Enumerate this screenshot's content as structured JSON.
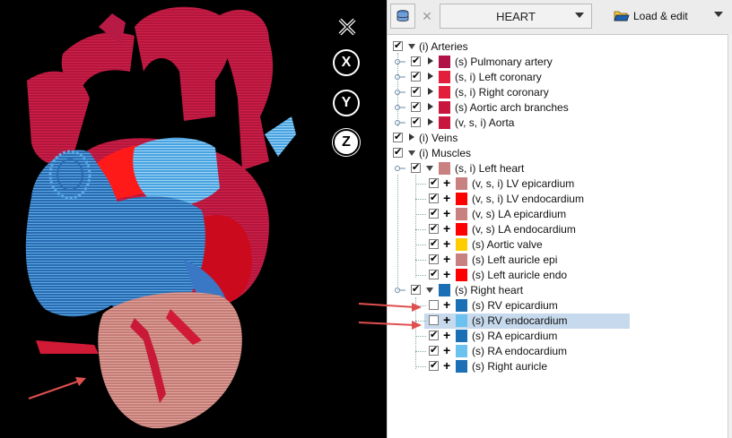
{
  "toolbar": {
    "model_name": "HEART",
    "load_edit_label": "Load & edit",
    "icons": {
      "database": "database-icon",
      "clear": "clear-x-icon",
      "folder": "folder-open-icon"
    }
  },
  "viewport": {
    "axis_buttons": [
      {
        "label": "X",
        "active": false
      },
      {
        "label": "Y",
        "active": false
      },
      {
        "label": "Z",
        "active": true
      }
    ],
    "close_icon": "close-icon"
  },
  "tree": {
    "groups": {
      "arteries": "(i) Arteries",
      "veins": "(i) Veins",
      "muscles": "(i) Muscles",
      "left_heart": "(s, i) Left heart",
      "right_heart": "(s) Right heart"
    },
    "arteries": [
      {
        "label": "(s) Pulmonary artery",
        "color": "#b01248"
      },
      {
        "label": "(s, i) Left coronary",
        "color": "#e2203c"
      },
      {
        "label": "(s, i) Right coronary",
        "color": "#e2203c"
      },
      {
        "label": "(s) Aortic arch branches",
        "color": "#c8163e"
      },
      {
        "label": "(v, s, i) Aorta",
        "color": "#c8163e"
      }
    ],
    "left_heart_color": "#c98080",
    "left_heart": [
      {
        "label": "(v, s, i) LV epicardium",
        "color": "#c98080"
      },
      {
        "label": "(v, s, i) LV endocardium",
        "color": "#ff0000"
      },
      {
        "label": "(v, s) LA epicardium",
        "color": "#c98080"
      },
      {
        "label": "(v, s) LA endocardium",
        "color": "#ff0000"
      },
      {
        "label": "(s) Aortic valve",
        "color": "#ffcc00"
      },
      {
        "label": "(s) Left auricle epi",
        "color": "#c98080"
      },
      {
        "label": "(s) Left auricle endo",
        "color": "#ff0000"
      }
    ],
    "right_heart_color": "#1a6fb5",
    "right_heart": [
      {
        "label": "(s) RV epicardium",
        "color": "#1a6fb5",
        "checked": false
      },
      {
        "label": "(s) RV endocardium",
        "color": "#6cc2ee",
        "checked": false,
        "selected": true
      },
      {
        "label": "(s) RA epicardium",
        "color": "#1a6fb5",
        "checked": true
      },
      {
        "label": "(s) RA endocardium",
        "color": "#6cc2ee",
        "checked": true
      },
      {
        "label": "(s) Right auricle",
        "color": "#1a6fb5",
        "checked": true
      }
    ]
  }
}
